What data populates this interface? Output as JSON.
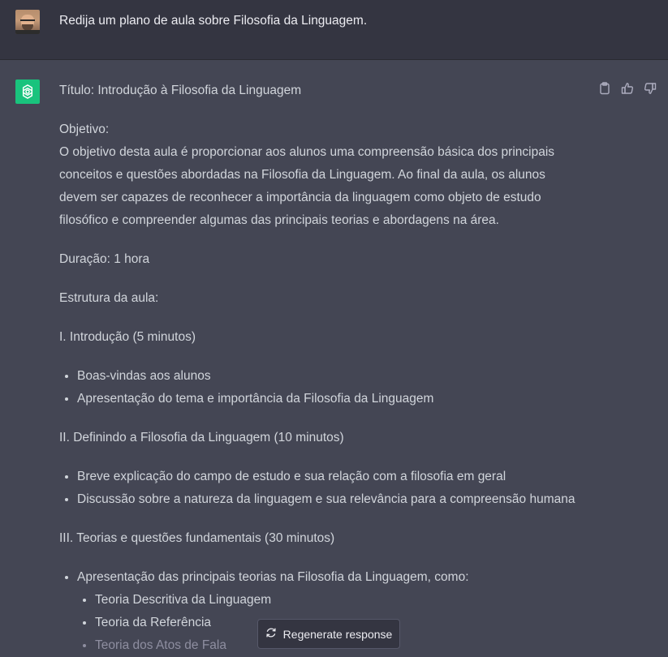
{
  "user_message": "Redija um plano de aula sobre Filosofia da Linguagem.",
  "response": {
    "title": "Título: Introdução à Filosofia da Linguagem",
    "objective_label": "Objetivo:",
    "objective_lines": [
      "O objetivo desta aula é proporcionar aos alunos uma compreensão básica dos principais",
      "conceitos e questões abordadas na Filosofia da Linguagem. Ao final da aula, os alunos",
      "devem ser capazes de reconhecer a importância da linguagem como objeto de estudo",
      "filosófico e compreender algumas das principais teorias e abordagens na área."
    ],
    "duration": "Duração: 1 hora",
    "structure_label": "Estrutura da aula:",
    "section1": {
      "heading": "I. Introdução (5 minutos)",
      "items": [
        "Boas-vindas aos alunos",
        "Apresentação do tema e importância da Filosofia da Linguagem"
      ]
    },
    "section2": {
      "heading": "II. Definindo a Filosofia da Linguagem (10 minutos)",
      "items": [
        "Breve explicação do campo de estudo e sua relação com a filosofia em geral",
        "Discussão sobre a natureza da linguagem e sua relevância para a compreensão humana"
      ]
    },
    "section3": {
      "heading": "III. Teorias e questões fundamentais (30 minutos)",
      "item": "Apresentação das principais teorias na Filosofia da Linguagem, como:",
      "subitems": [
        "Teoria Descritiva da Linguagem",
        "Teoria da Referência",
        "Teoria dos Atos de Fala"
      ]
    }
  },
  "actions": {
    "copy_icon": "clipboard-icon",
    "like_icon": "thumbs-up-icon",
    "dislike_icon": "thumbs-down-icon"
  },
  "regenerate_button": {
    "label": "Regenerate response",
    "icon": "refresh-icon"
  },
  "colors": {
    "background": "#444654",
    "user_background": "#343541",
    "accent": "#19c37d",
    "text": "#d1d5db"
  }
}
